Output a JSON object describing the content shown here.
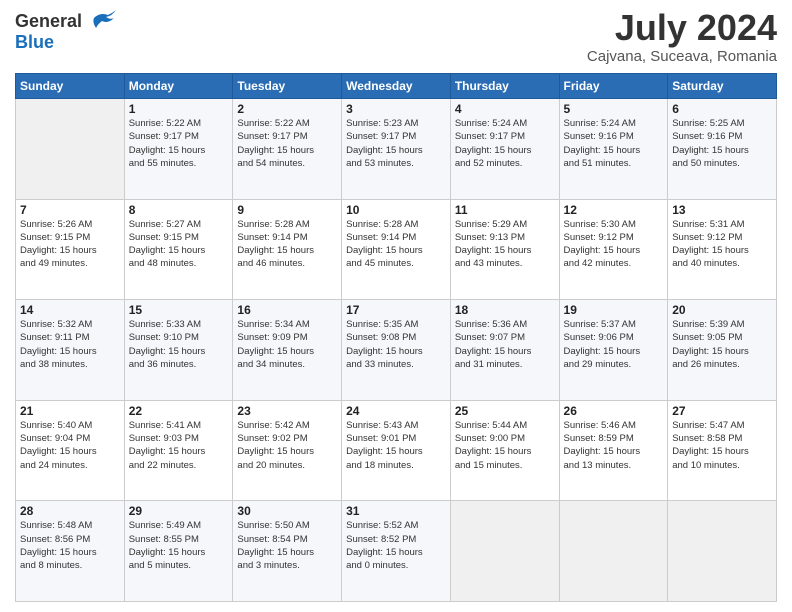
{
  "header": {
    "logo_general": "General",
    "logo_blue": "Blue",
    "title": "July 2024",
    "location": "Cajvana, Suceava, Romania"
  },
  "weekdays": [
    "Sunday",
    "Monday",
    "Tuesday",
    "Wednesday",
    "Thursday",
    "Friday",
    "Saturday"
  ],
  "weeks": [
    [
      {
        "day": "",
        "info": ""
      },
      {
        "day": "1",
        "info": "Sunrise: 5:22 AM\nSunset: 9:17 PM\nDaylight: 15 hours\nand 55 minutes."
      },
      {
        "day": "2",
        "info": "Sunrise: 5:22 AM\nSunset: 9:17 PM\nDaylight: 15 hours\nand 54 minutes."
      },
      {
        "day": "3",
        "info": "Sunrise: 5:23 AM\nSunset: 9:17 PM\nDaylight: 15 hours\nand 53 minutes."
      },
      {
        "day": "4",
        "info": "Sunrise: 5:24 AM\nSunset: 9:17 PM\nDaylight: 15 hours\nand 52 minutes."
      },
      {
        "day": "5",
        "info": "Sunrise: 5:24 AM\nSunset: 9:16 PM\nDaylight: 15 hours\nand 51 minutes."
      },
      {
        "day": "6",
        "info": "Sunrise: 5:25 AM\nSunset: 9:16 PM\nDaylight: 15 hours\nand 50 minutes."
      }
    ],
    [
      {
        "day": "7",
        "info": "Sunrise: 5:26 AM\nSunset: 9:15 PM\nDaylight: 15 hours\nand 49 minutes."
      },
      {
        "day": "8",
        "info": "Sunrise: 5:27 AM\nSunset: 9:15 PM\nDaylight: 15 hours\nand 48 minutes."
      },
      {
        "day": "9",
        "info": "Sunrise: 5:28 AM\nSunset: 9:14 PM\nDaylight: 15 hours\nand 46 minutes."
      },
      {
        "day": "10",
        "info": "Sunrise: 5:28 AM\nSunset: 9:14 PM\nDaylight: 15 hours\nand 45 minutes."
      },
      {
        "day": "11",
        "info": "Sunrise: 5:29 AM\nSunset: 9:13 PM\nDaylight: 15 hours\nand 43 minutes."
      },
      {
        "day": "12",
        "info": "Sunrise: 5:30 AM\nSunset: 9:12 PM\nDaylight: 15 hours\nand 42 minutes."
      },
      {
        "day": "13",
        "info": "Sunrise: 5:31 AM\nSunset: 9:12 PM\nDaylight: 15 hours\nand 40 minutes."
      }
    ],
    [
      {
        "day": "14",
        "info": "Sunrise: 5:32 AM\nSunset: 9:11 PM\nDaylight: 15 hours\nand 38 minutes."
      },
      {
        "day": "15",
        "info": "Sunrise: 5:33 AM\nSunset: 9:10 PM\nDaylight: 15 hours\nand 36 minutes."
      },
      {
        "day": "16",
        "info": "Sunrise: 5:34 AM\nSunset: 9:09 PM\nDaylight: 15 hours\nand 34 minutes."
      },
      {
        "day": "17",
        "info": "Sunrise: 5:35 AM\nSunset: 9:08 PM\nDaylight: 15 hours\nand 33 minutes."
      },
      {
        "day": "18",
        "info": "Sunrise: 5:36 AM\nSunset: 9:07 PM\nDaylight: 15 hours\nand 31 minutes."
      },
      {
        "day": "19",
        "info": "Sunrise: 5:37 AM\nSunset: 9:06 PM\nDaylight: 15 hours\nand 29 minutes."
      },
      {
        "day": "20",
        "info": "Sunrise: 5:39 AM\nSunset: 9:05 PM\nDaylight: 15 hours\nand 26 minutes."
      }
    ],
    [
      {
        "day": "21",
        "info": "Sunrise: 5:40 AM\nSunset: 9:04 PM\nDaylight: 15 hours\nand 24 minutes."
      },
      {
        "day": "22",
        "info": "Sunrise: 5:41 AM\nSunset: 9:03 PM\nDaylight: 15 hours\nand 22 minutes."
      },
      {
        "day": "23",
        "info": "Sunrise: 5:42 AM\nSunset: 9:02 PM\nDaylight: 15 hours\nand 20 minutes."
      },
      {
        "day": "24",
        "info": "Sunrise: 5:43 AM\nSunset: 9:01 PM\nDaylight: 15 hours\nand 18 minutes."
      },
      {
        "day": "25",
        "info": "Sunrise: 5:44 AM\nSunset: 9:00 PM\nDaylight: 15 hours\nand 15 minutes."
      },
      {
        "day": "26",
        "info": "Sunrise: 5:46 AM\nSunset: 8:59 PM\nDaylight: 15 hours\nand 13 minutes."
      },
      {
        "day": "27",
        "info": "Sunrise: 5:47 AM\nSunset: 8:58 PM\nDaylight: 15 hours\nand 10 minutes."
      }
    ],
    [
      {
        "day": "28",
        "info": "Sunrise: 5:48 AM\nSunset: 8:56 PM\nDaylight: 15 hours\nand 8 minutes."
      },
      {
        "day": "29",
        "info": "Sunrise: 5:49 AM\nSunset: 8:55 PM\nDaylight: 15 hours\nand 5 minutes."
      },
      {
        "day": "30",
        "info": "Sunrise: 5:50 AM\nSunset: 8:54 PM\nDaylight: 15 hours\nand 3 minutes."
      },
      {
        "day": "31",
        "info": "Sunrise: 5:52 AM\nSunset: 8:52 PM\nDaylight: 15 hours\nand 0 minutes."
      },
      {
        "day": "",
        "info": ""
      },
      {
        "day": "",
        "info": ""
      },
      {
        "day": "",
        "info": ""
      }
    ]
  ]
}
